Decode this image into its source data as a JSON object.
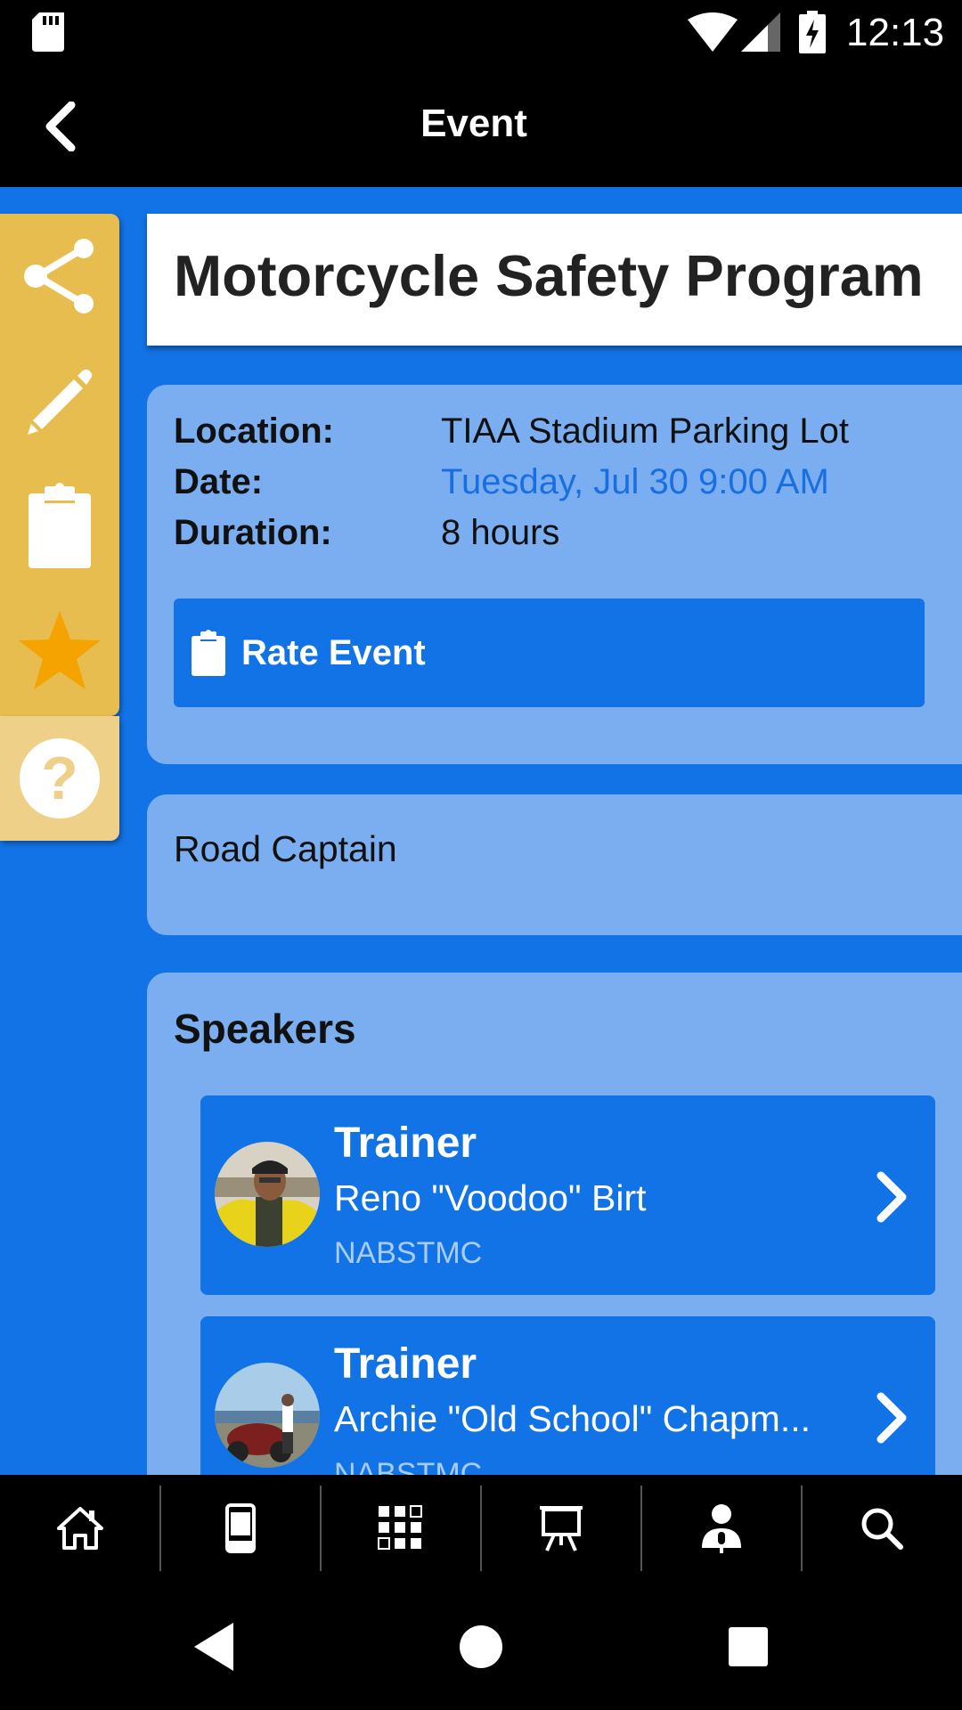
{
  "status_bar": {
    "time": "12:13",
    "icons": [
      "sd-card-icon",
      "wifi-icon",
      "cell-signal-icon",
      "battery-charging-icon"
    ]
  },
  "app_bar": {
    "title": "Event",
    "back_icon": "chevron-left-icon"
  },
  "side_actions": [
    "share-icon",
    "pencil-icon",
    "clipboard-icon",
    "star-icon"
  ],
  "help": {
    "glyph": "?"
  },
  "event": {
    "title": "Motorcycle Safety Program",
    "location_label": "Location:",
    "location": "TIAA Stadium Parking Lot",
    "date_label": "Date:",
    "date": "Tuesday, Jul 30 9:00 AM",
    "duration_label": "Duration:",
    "duration": "8 hours",
    "rate_button": "Rate Event"
  },
  "role": {
    "text": "Road Captain"
  },
  "speakers": {
    "heading": "Speakers",
    "items": [
      {
        "role": "Trainer",
        "name": "Reno \"Voodoo\" Birt",
        "org": "NABSTMC"
      },
      {
        "role": "Trainer",
        "name": "Archie \"Old School\" Chapm...",
        "org": "NABSTMC"
      }
    ]
  },
  "tab_bar": [
    "home-icon",
    "phone-icon",
    "grid-icon",
    "presentation-icon",
    "speaker-icon",
    "search-icon"
  ],
  "nav_bar": [
    "back-triangle-icon",
    "home-circle-icon",
    "recents-square-icon"
  ],
  "colors": {
    "accent_blue": "#1273e6",
    "card_blue": "#7aaef0",
    "gold": "#e8bd4f",
    "date_link": "#1a6fe0"
  }
}
